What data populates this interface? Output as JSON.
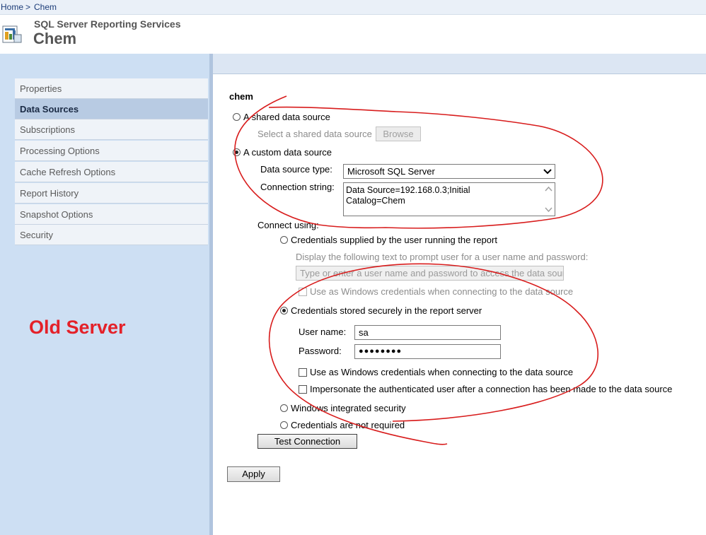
{
  "breadcrumb": {
    "home": "Home",
    "separator": ">",
    "current": "Chem"
  },
  "header": {
    "app_name": "SQL Server Reporting Services",
    "item_title": "Chem",
    "logo_icon": "report-icon"
  },
  "sidebar": {
    "items": [
      {
        "label": "Properties"
      },
      {
        "label": "Data Sources",
        "active": true
      },
      {
        "label": "Subscriptions"
      },
      {
        "label": "Processing Options"
      },
      {
        "label": "Cache Refresh Options"
      },
      {
        "label": "Report History"
      },
      {
        "label": "Snapshot Options"
      },
      {
        "label": "Security"
      }
    ]
  },
  "annotation": {
    "label": "Old Server",
    "color": "#e42129"
  },
  "form": {
    "datasource_name": "chem",
    "shared_option": {
      "label": "A shared data source",
      "selected": false
    },
    "shared_select_label": "Select a shared data source",
    "browse_button": "Browse",
    "custom_option": {
      "label": "A custom data source",
      "selected": true
    },
    "type_label": "Data source type:",
    "type_value": "Microsoft SQL Server",
    "conn_label": "Connection string:",
    "conn_line1": "Data Source=192.168.0.3;Initial",
    "conn_line2": "Catalog=Chem",
    "connect_using_label": "Connect using:",
    "cred_user_option": {
      "label": "Credentials supplied by the user running the report",
      "selected": false
    },
    "prompt_label": "Display the following text to prompt user for a user name and password:",
    "prompt_value": "Type or enter a user name and password to access the data sour",
    "prompt_windows_check": {
      "label": "Use as Windows credentials when connecting to the data source",
      "checked": false
    },
    "cred_stored_option": {
      "label": "Credentials stored securely in the report server",
      "selected": true
    },
    "username_label": "User name:",
    "username_value": "sa",
    "password_label": "Password:",
    "password_value": "●●●●●●●●",
    "stored_windows_check": {
      "label": "Use as Windows credentials when connecting to the data source",
      "checked": false
    },
    "impersonate_check": {
      "label": "Impersonate the authenticated user after a connection has been made to the data source",
      "checked": false
    },
    "windows_integrated_option": {
      "label": "Windows integrated security",
      "selected": false
    },
    "not_required_option": {
      "label": "Credentials are not required",
      "selected": false
    },
    "test_button": "Test Connection",
    "apply_button": "Apply"
  }
}
